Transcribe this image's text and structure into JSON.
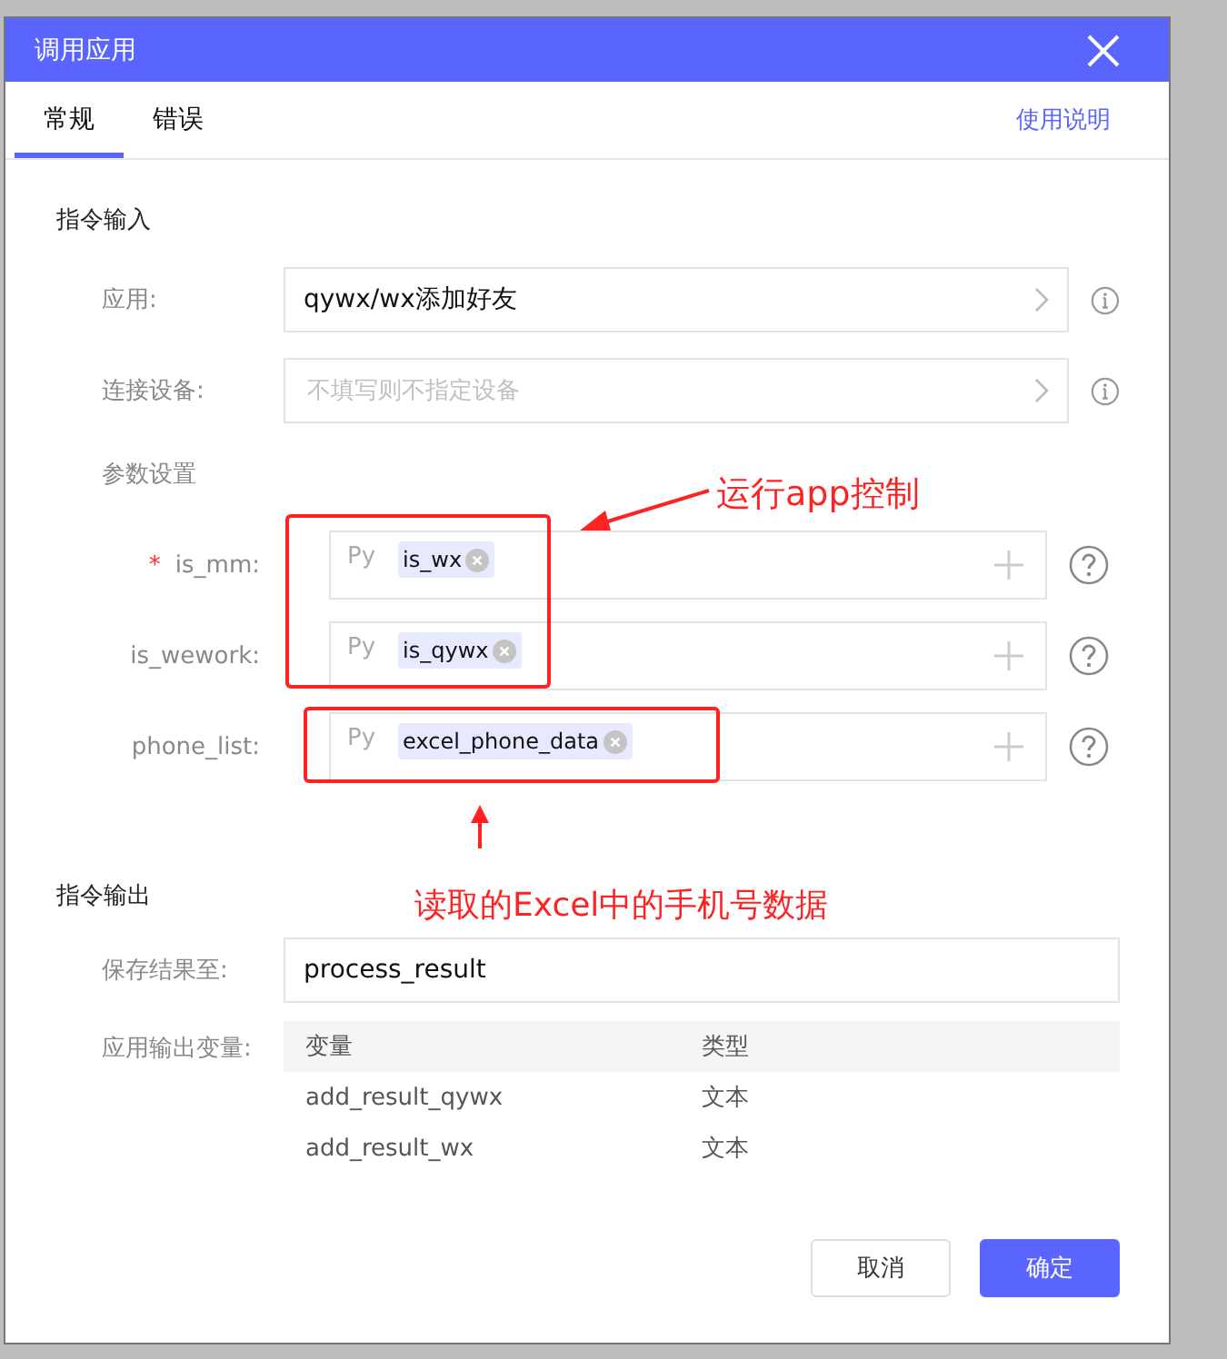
{
  "window": {
    "title": "调用应用"
  },
  "tabs": [
    {
      "label": "常规",
      "selected": true
    },
    {
      "label": "错误",
      "selected": false
    }
  ],
  "help_link": "使用说明",
  "input_section": {
    "title": "指令输入",
    "app": {
      "label": "应用:",
      "value": "qywx/wx添加好友"
    },
    "device": {
      "label": "连接设备:",
      "placeholder": "不填写则不指定设备"
    }
  },
  "params": {
    "title": "参数设置",
    "required_mark": "*",
    "items": [
      {
        "label": "is_mm:",
        "required": true,
        "prefix": "Py",
        "tag": "is_wx"
      },
      {
        "label": "is_wework:",
        "required": false,
        "prefix": "Py",
        "tag": "is_qywx"
      },
      {
        "label": "phone_list:",
        "required": false,
        "prefix": "Py",
        "tag": "excel_phone_data"
      }
    ]
  },
  "output_section": {
    "title": "指令输出",
    "save": {
      "label": "保存结果至:",
      "value": "process_result"
    },
    "variables": {
      "label": "应用输出变量:",
      "columns": [
        "变量",
        "类型"
      ],
      "rows": [
        [
          "add_result_qywx",
          "文本"
        ],
        [
          "add_result_wx",
          "文本"
        ]
      ]
    }
  },
  "buttons": [
    {
      "label": "取消",
      "kind": "secondary"
    },
    {
      "label": "确定",
      "kind": "primary"
    }
  ],
  "annotations": [
    {
      "text": "运行app控制"
    },
    {
      "text": "读取的Excel中的手机号数据"
    }
  ]
}
